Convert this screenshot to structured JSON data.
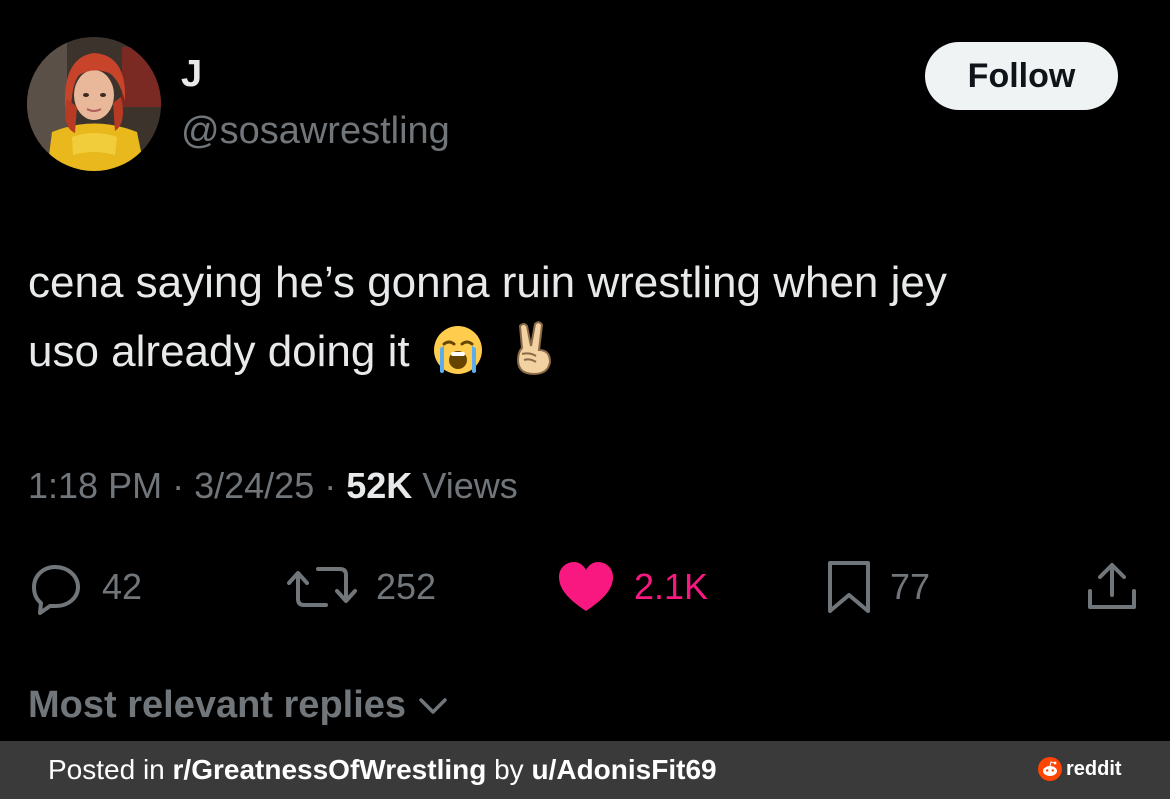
{
  "author": {
    "display_name": "J",
    "handle": "@sosawrestling"
  },
  "follow_button": {
    "label": "Follow"
  },
  "tweet": {
    "line1": "cena saying he’s gonna ruin wrestling when jey",
    "line2": "uso already doing it",
    "emojis": [
      "loudly-crying-face",
      "victory-hand"
    ]
  },
  "meta": {
    "time": "1:18 PM",
    "separator": "·",
    "date": "3/24/25",
    "views_count": "52K",
    "views_label": "Views"
  },
  "actions": {
    "replies": "42",
    "reposts": "252",
    "likes": "2.1K",
    "bookmarks": "77"
  },
  "replies_sort": {
    "label": "Most relevant replies"
  },
  "footer": {
    "posted_in": "Posted in",
    "subreddit": "r/GreatnessOfWrestling",
    "by": "by",
    "user": "u/AdonisFit69",
    "brand": "reddit"
  },
  "colors": {
    "background": "#000000",
    "primary_text": "#e7e9ea",
    "secondary_text": "#71767b",
    "like": "#f91880",
    "follow_bg": "#eff3f4",
    "footer_bg": "#3a3a3a",
    "reddit": "#ff4500"
  }
}
